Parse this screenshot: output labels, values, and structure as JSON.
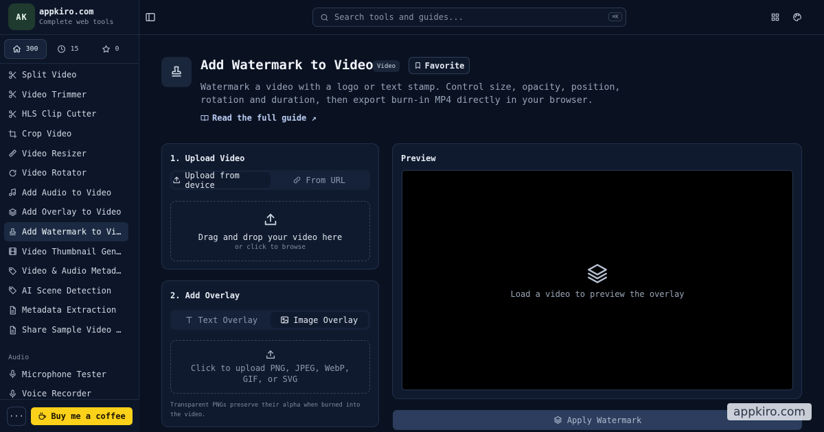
{
  "brand": {
    "logo_text": "AK",
    "name": "appkiro.com",
    "tagline": "Complete web tools"
  },
  "stats": {
    "home": "300",
    "history": "15",
    "favorites": "0"
  },
  "nav": {
    "items": [
      {
        "label": "Split Video",
        "icon": "scissors-icon"
      },
      {
        "label": "Video Trimmer",
        "icon": "scissors-icon"
      },
      {
        "label": "HLS Clip Cutter",
        "icon": "scissors-icon"
      },
      {
        "label": "Crop Video",
        "icon": "crop-icon"
      },
      {
        "label": "Video Resizer",
        "icon": "ruler-icon"
      },
      {
        "label": "Video Rotator",
        "icon": "rotate-icon"
      },
      {
        "label": "Add Audio to Video",
        "icon": "music-icon"
      },
      {
        "label": "Add Overlay to Video",
        "icon": "layers-icon"
      },
      {
        "label": "Add Watermark to Video",
        "icon": "stamp-icon",
        "active": true
      },
      {
        "label": "Video Thumbnail Gener…",
        "icon": "film-icon"
      },
      {
        "label": "Video & Audio Metadat…",
        "icon": "tag-icon"
      },
      {
        "label": "AI Scene Detection",
        "icon": "tag-icon"
      },
      {
        "label": "Metadata Extraction",
        "icon": "file-icon"
      },
      {
        "label": "Share Sample Video Fi…",
        "icon": "file-icon"
      }
    ],
    "section_audio": "Audio",
    "audio_items": [
      {
        "label": "Microphone Tester",
        "icon": "mic-icon"
      },
      {
        "label": "Voice Recorder",
        "icon": "mic-icon"
      }
    ]
  },
  "footer": {
    "more": "···",
    "coffee": "Buy me a coffee"
  },
  "search": {
    "placeholder": "Search tools and guides...",
    "shortcut": "⌘K"
  },
  "tool": {
    "title": "Add Watermark to Video",
    "badge": "Video",
    "favorite": "Favorite",
    "description": "Watermark a video with a logo or text stamp. Control size, opacity, position, rotation and duration, then export burn-in MP4 directly in your browser.",
    "guide_link": "Read the full guide ↗"
  },
  "upload": {
    "title": "1. Upload Video",
    "tab_device": "Upload from device",
    "tab_url": "From URL",
    "drop_main": "Drag and drop your video here",
    "drop_sub": "or click to browse"
  },
  "overlay": {
    "title": "2. Add Overlay",
    "tab_text": "Text Overlay",
    "tab_image": "Image Overlay",
    "drop_text": "Click to upload PNG, JPEG, WebP, GIF, or SVG",
    "hint": "Transparent PNGs preserve their alpha when burned into the video."
  },
  "preview": {
    "title": "Preview",
    "empty": "Load a video to preview the overlay"
  },
  "apply": "Apply Watermark",
  "watermark": "appkiro.com"
}
